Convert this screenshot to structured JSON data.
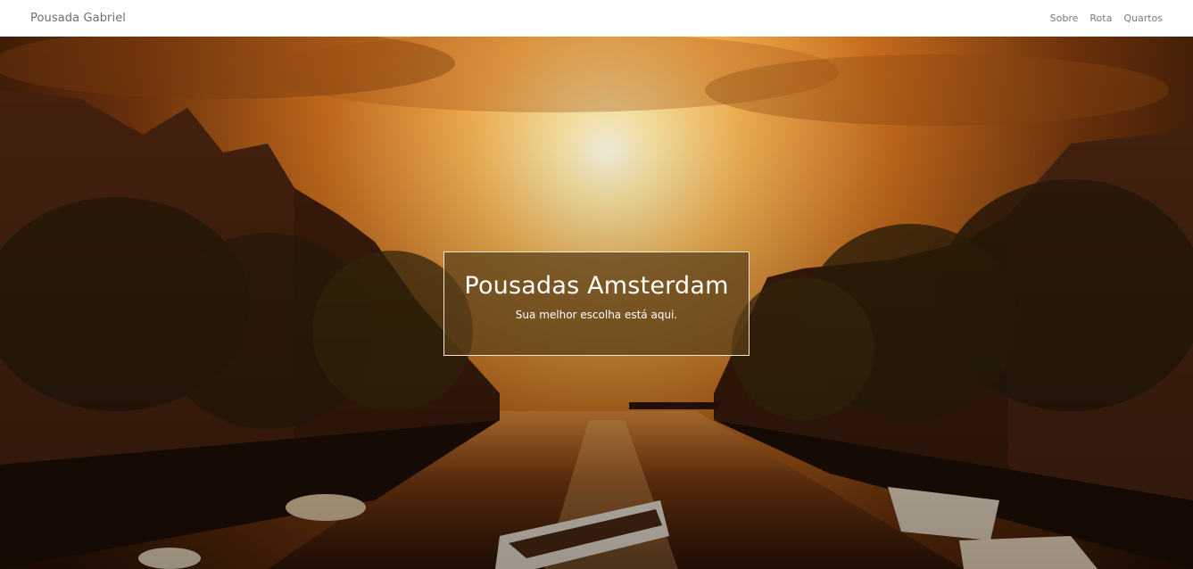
{
  "navbar": {
    "brand": "Pousada Gabriel",
    "links": [
      "Sobre",
      "Rota",
      "Quartos"
    ]
  },
  "hero": {
    "title": "Pousadas Amsterdam",
    "subtitle": "Sua melhor escolha está aqui."
  },
  "colors": {
    "navbar_bg": "#ffffff",
    "nav_text": "#7a7a7a",
    "overlay": "#5a3e19",
    "sky_glow": "#fff2c8",
    "sky_dark": "#7a3e10"
  }
}
